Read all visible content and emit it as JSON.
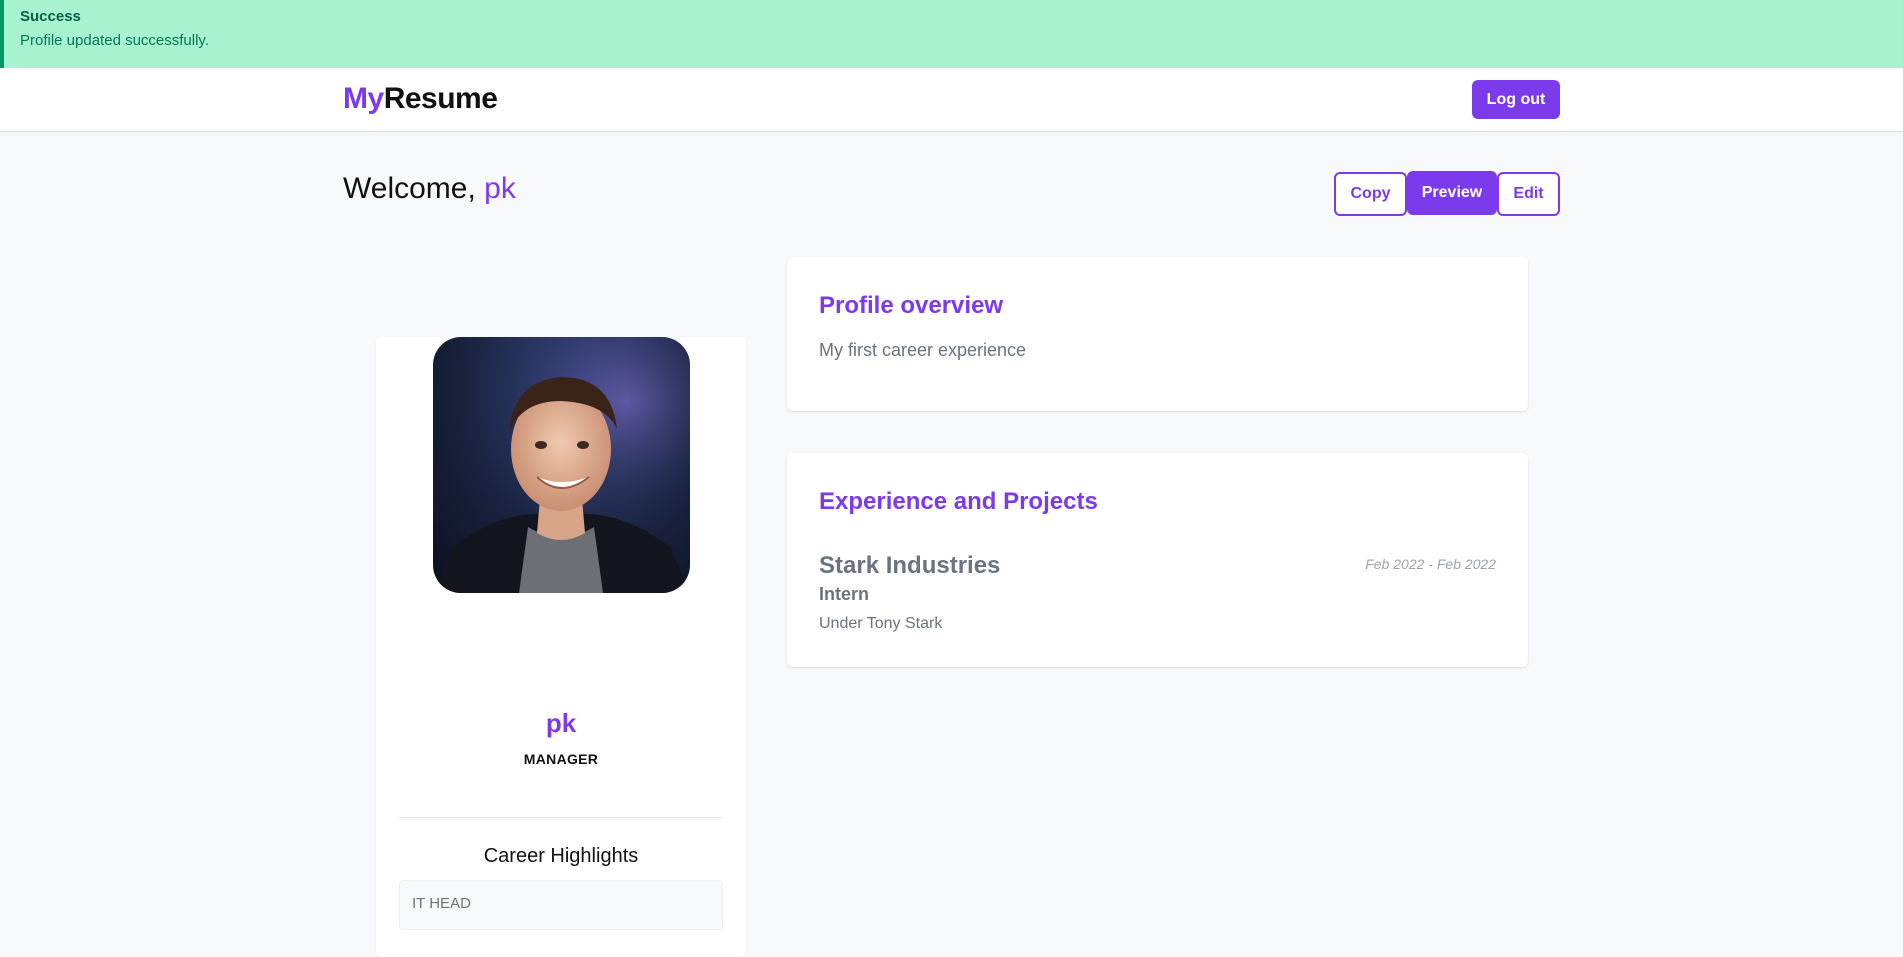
{
  "alert": {
    "title": "Success",
    "message": "Profile updated successfully."
  },
  "nav": {
    "brand_part1": "My",
    "brand_part2": "Resume",
    "logout_label": "Log out"
  },
  "welcome": {
    "prefix": "Welcome, ",
    "username": "pk"
  },
  "actions": {
    "copy_label": "Copy",
    "preview_label": "Preview",
    "edit_label": "Edit"
  },
  "profile": {
    "name": "pk",
    "role": "MANAGER",
    "highlights_title": "Career Highlights",
    "highlights": [
      "IT HEAD"
    ]
  },
  "overview": {
    "title": "Profile overview",
    "text": "My first career experience"
  },
  "experience": {
    "title": "Experience and Projects",
    "items": [
      {
        "company": "Stark Industries",
        "dates": "Feb 2022 - Feb 2022",
        "role": "Intern",
        "description": "Under Tony Stark"
      }
    ]
  },
  "colors": {
    "accent": "#7c3aed",
    "success_bg": "#a7f3d0",
    "success_text": "#065f46"
  }
}
